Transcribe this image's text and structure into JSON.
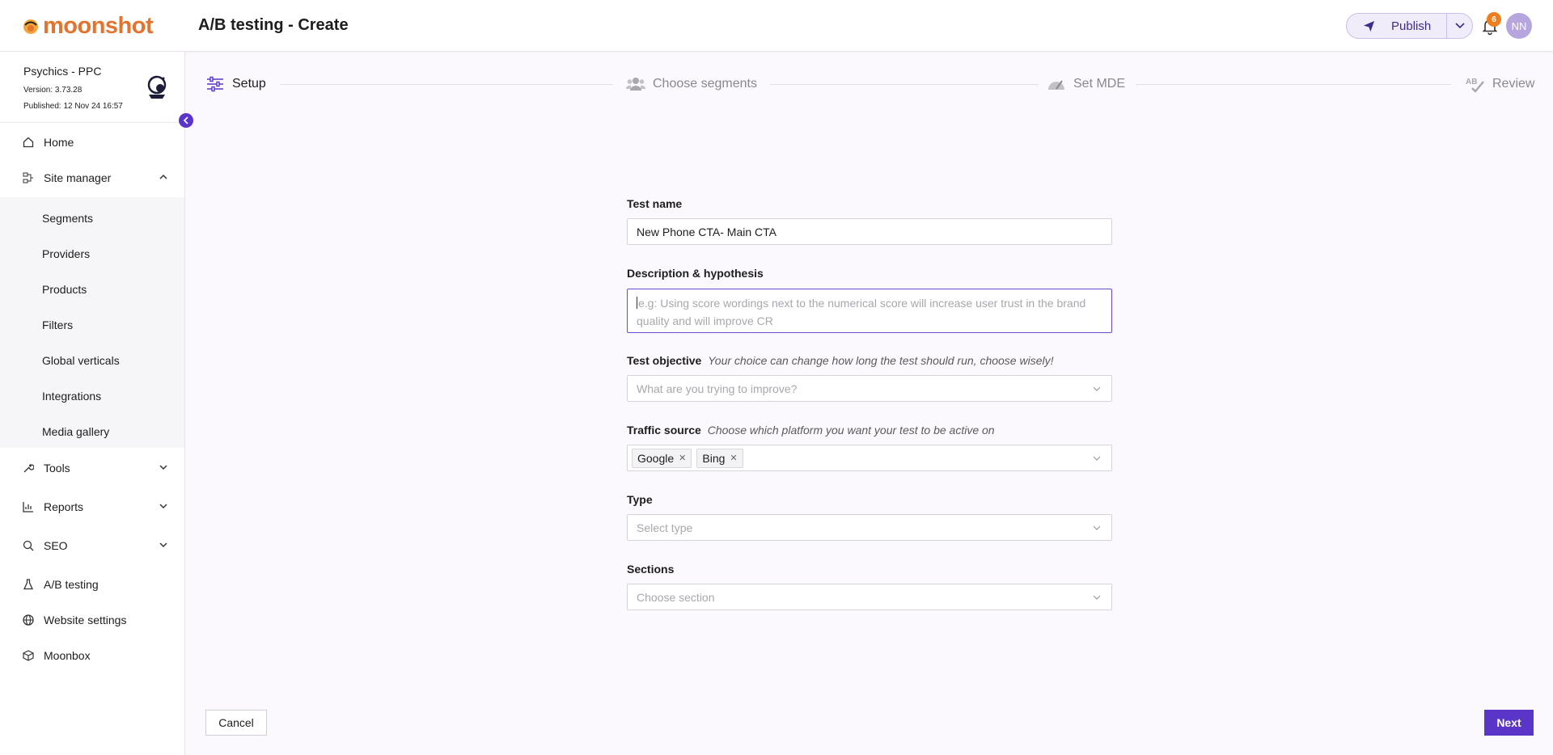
{
  "header": {
    "logo_text": "moonshot",
    "title": "A/B testing - Create",
    "publish_label": "Publish",
    "notifications_count": "6",
    "avatar_initials": "NN"
  },
  "site": {
    "name": "Psychics - PPC",
    "version": "Version: 3.73.28",
    "published": "Published: 12 Nov 24 16:57"
  },
  "nav": {
    "home": "Home",
    "site_manager": "Site manager",
    "site_manager_items": [
      "Segments",
      "Providers",
      "Products",
      "Filters",
      "Global verticals",
      "Integrations",
      "Media gallery"
    ],
    "tools": "Tools",
    "reports": "Reports",
    "seo": "SEO",
    "ab_testing": "A/B testing",
    "website_settings": "Website settings",
    "moonbox": "Moonbox"
  },
  "steps": [
    "Setup",
    "Choose segments",
    "Set MDE",
    "Review"
  ],
  "form": {
    "test_name_label": "Test name",
    "test_name_value": "New Phone CTA- Main CTA",
    "description_label": "Description & hypothesis",
    "description_placeholder": "e.g: Using score wordings next to the numerical score will increase user trust in the brand quality and will improve CR",
    "objective_label": "Test objective",
    "objective_hint": "Your choice can change how long the test should run, choose wisely!",
    "objective_placeholder": "What are you trying to improve?",
    "traffic_label": "Traffic source",
    "traffic_hint": "Choose which platform you want your test to be active on",
    "traffic_tags": [
      "Google",
      "Bing"
    ],
    "type_label": "Type",
    "type_placeholder": "Select type",
    "sections_label": "Sections",
    "sections_placeholder": "Choose section"
  },
  "footer": {
    "cancel_label": "Cancel",
    "next_label": "Next"
  },
  "colors": {
    "accent": "#5b35c7",
    "logo": "#e2742f",
    "badge": "#f07d1e"
  }
}
